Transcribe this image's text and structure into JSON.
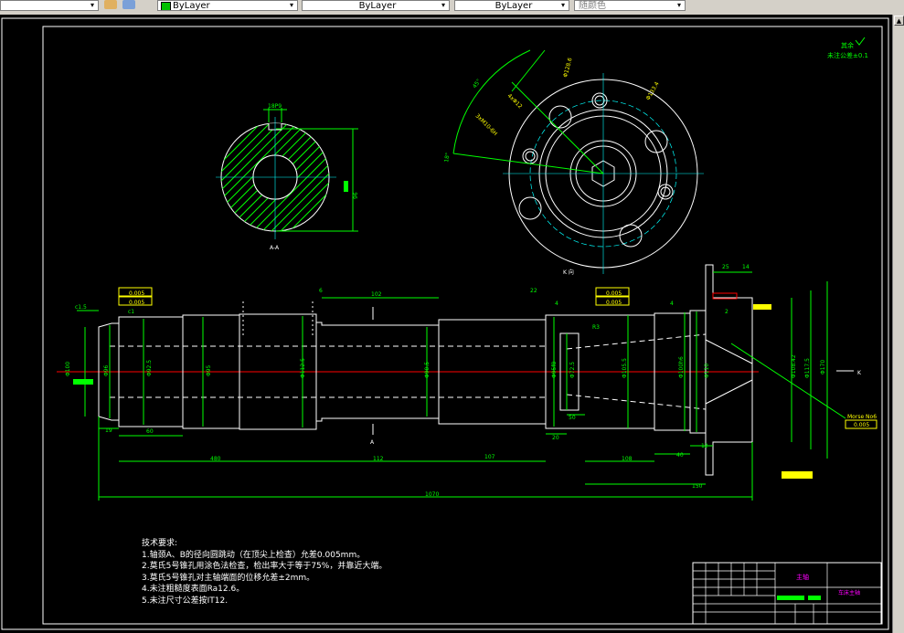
{
  "toolbar": {
    "color_control": "ByLayer",
    "linetype_control": "ByLayer",
    "lineweight_control": "ByLayer",
    "plotstyle_control": "随颜色"
  },
  "drawing": {
    "top_right_note_1": "其余",
    "top_right_note_2": "未注公差±0.1",
    "section_label": "A-A",
    "view_label": "K 向",
    "dims": {
      "total_length": "1070",
      "len_480": "480",
      "len_112": "112",
      "len_107": "107",
      "len_108": "108",
      "len_150": "150",
      "len_40": "40",
      "len_12": "12",
      "len_19": "19",
      "len_60": "60",
      "len_102": "102",
      "len_20": "20",
      "len_50": "50",
      "len_25": "25",
      "len_14": "14",
      "len_4a": "4",
      "len_4b": "4",
      "len_6": "6",
      "len_22": "22",
      "len_2": "2",
      "angle_45": "45°",
      "angle_18": "18°",
      "key_18": "18P9",
      "key_96": "96"
    },
    "diameters": {
      "d1": "Φ100",
      "d2": "Φ96",
      "d3": "Φ92.5",
      "d4": "Φ95",
      "d5": "Φ112.5",
      "d6": "Φ90.5",
      "d7": "Φ95f8",
      "d8": "Φ72.5",
      "d9": "Φ105.5",
      "d10": "Φ100h6",
      "d11": "Φ108.42",
      "d12": "Φ117.5",
      "d13": "Φ170",
      "d14": "Φ110",
      "d15": "Φ108h6"
    },
    "tolerances": {
      "runout": "0.005",
      "taper": "Morse No6",
      "morse_tol": "0.005"
    },
    "labels": {
      "A_mark": "A",
      "K_mark": "K",
      "chamfer_left": "c1.5",
      "chamfer_left2": "c1",
      "r_label": "R3"
    }
  },
  "tech_notes": {
    "title": "技术要求:",
    "items": [
      "1.轴颈A、B的径向圆跳动（在顶尖上检查）允差0.005mm。",
      "2.莫氏5号锥孔用涂色法检查，检出率大于等于75%，并靠近大端。",
      "3.莫氏5号锥孔对主轴端面的位移允差±2mm。",
      "4.未注粗糙度表面Ra12.6。",
      "5.未注尺寸公差按IT12."
    ]
  },
  "title_block": {
    "part_name": "主轴",
    "drawing_name": "车床主轴"
  },
  "colors": {
    "frame": "#ffffff",
    "outline": "#ffffff",
    "dimension": "#00ff00",
    "center_line": "#ff0000",
    "hatch": "#00ff00",
    "hidden": "#ffffff",
    "annotation": "#ffff00",
    "title_text": "#ff00ff",
    "cyan": "#00ffff"
  }
}
